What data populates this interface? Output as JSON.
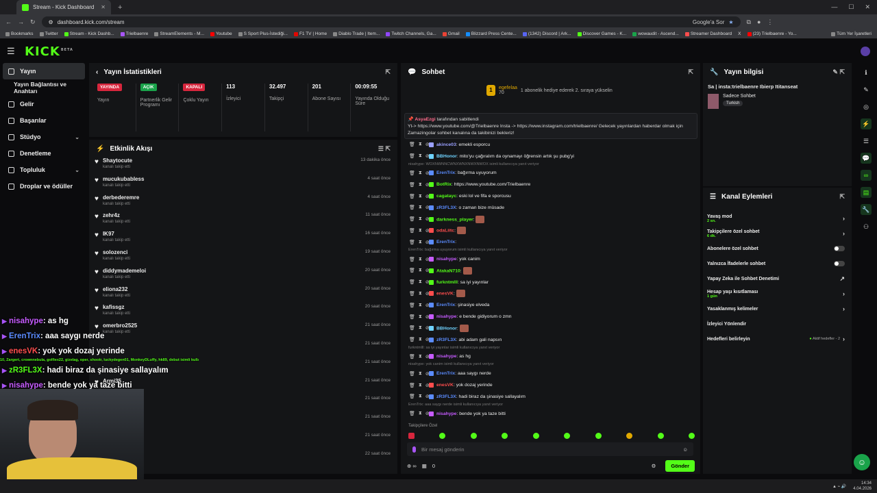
{
  "browser": {
    "tab_title": "Stream - Kick Dashboard",
    "url": "dashboard.kick.com/stream",
    "search_label": "Google'a Sor",
    "bookmarks": [
      "Bookmarks",
      "Twitter",
      "Stream - Kick Dashb...",
      "Trielbaenre",
      "StreamElements - M...",
      "Youtube",
      "S Sport Plus-İstediği...",
      "F1 TV | Home",
      "Diablo Trade | Item...",
      "Twitch Channels, Ga...",
      "Gmail",
      "Blizzard Press Cente...",
      "(1342) Discord | Ark...",
      "Discover Games - K...",
      "wowaudit - Ascend...",
      "Streamer Dashboard",
      "X",
      "(23) Trielbaenre - Yo..."
    ],
    "all_bookmarks": "Tüm Yer İşaretleri"
  },
  "sidebar": {
    "items": [
      {
        "label": "Yayın"
      },
      {
        "label": "Yayın Bağlantısı ve Anahtarı"
      },
      {
        "label": "Gelir"
      },
      {
        "label": "Başarılar"
      },
      {
        "label": "Stüdyo"
      },
      {
        "label": "Denetleme"
      },
      {
        "label": "Topluluk"
      },
      {
        "label": "Droplar ve ödüller"
      }
    ]
  },
  "stats": {
    "title": "Yayın İstatistikleri",
    "items": [
      {
        "pill": "YAYINDA",
        "label": "Yayın",
        "color": "#d7263d"
      },
      {
        "pill": "AÇIK",
        "label": "Partnerlik Gelir Programı",
        "color": "#1aa34a"
      },
      {
        "pill": "KAPALI",
        "label": "Çoklu Yayın",
        "color": "#d7263d"
      },
      {
        "value": "113",
        "label": "İzleyici"
      },
      {
        "value": "32.497",
        "label": "Takipçi"
      },
      {
        "value": "201",
        "label": "Abone Sayısı"
      },
      {
        "value": "00:09:55",
        "label": "Yayında Olduğu Süre"
      }
    ]
  },
  "activity": {
    "title": "Etkinlik Akışı",
    "rows": [
      {
        "name": "Shaytocute",
        "sub": "kanalı takip etti",
        "when": "13 dakika önce"
      },
      {
        "name": "mucukubabless",
        "sub": "kanalı takip etti",
        "when": "4 saat önce"
      },
      {
        "name": "derbederemre",
        "sub": "kanalı takip etti",
        "when": "4 saat önce"
      },
      {
        "name": "zehr4z",
        "sub": "kanalı takip etti",
        "when": "11 saat önce"
      },
      {
        "name": "IK97",
        "sub": "kanalı takip etti",
        "when": "16 saat önce"
      },
      {
        "name": "solozenci",
        "sub": "kanalı takip etti",
        "when": "19 saat önce"
      },
      {
        "name": "diddymademeloi",
        "sub": "kanalı takip etti",
        "when": "20 saat önce"
      },
      {
        "name": "eliona232",
        "sub": "kanalı takip etti",
        "when": "20 saat önce"
      },
      {
        "name": "kafissgz",
        "sub": "kanalı takip etti",
        "when": "20 saat önce"
      },
      {
        "name": "omerbro2525",
        "sub": "kanalı takip etti",
        "when": "21 saat önce"
      },
      {
        "name": "",
        "sub": "",
        "when": "21 saat önce"
      },
      {
        "name": "",
        "sub": "",
        "when": "21 saat önce"
      },
      {
        "name": "Armi35",
        "sub": "",
        "when": "21 saat önce"
      },
      {
        "name": "",
        "sub": "",
        "when": "21 saat önce"
      },
      {
        "name": "",
        "sub": "",
        "when": "21 saat önce"
      },
      {
        "name": "",
        "sub": "",
        "when": "21 saat önce"
      },
      {
        "name": "",
        "sub": "",
        "when": "22 saat önce"
      }
    ]
  },
  "chat": {
    "title": "Sohbet",
    "hype_user": "egefelaa",
    "hype_count": "70",
    "hype_text": "1 abonelik hediye ederek 2. sıraya yükselin",
    "pinned_by": "AsyaEzgi",
    "pinned_by_suffix": "tarafından sabitlendi",
    "pinned_text": "Yt-> https://www.youtube.com/@Trielbaenre Insta -> https://www.instagram.com/trielbaenre/ Gelecek yayınlardan haberdar olmak için Zamazingolar sohbet kanalına da takibinizi bekleriz!",
    "messages": [
      {
        "user": "akince03",
        "text": "emekli esporcu",
        "color": "#9aa0ff"
      },
      {
        "user": "BBHonor",
        "text": "mito'yu çağıralım da oynamayı öğrensin artık şu pubg'yi",
        "color": "#6fd3ff"
      },
      {
        "reply": "nisahype: WOXNWNNCWNXWNXNWXNWOX isimli kullanıcıya yanıt veriyor"
      },
      {
        "user": "ErenTrix",
        "text": "bağırma uyuyorum",
        "color": "#5b8cff"
      },
      {
        "user": "BotRix",
        "text": "https://www.youtube.com/Trielbaenre",
        "color": "#53fc18"
      },
      {
        "user": "cagatayc",
        "text": "eski lol ve fifa e sporcusu",
        "color": "#53fc18"
      },
      {
        "user": "zR3FL3X",
        "text": "o zaman bize müsade",
        "color": "#5b8cff"
      },
      {
        "user": "darkness_player",
        "text": "",
        "color": "#53fc18",
        "emote": true
      },
      {
        "user": "odaLiitc",
        "text": "",
        "color": "#ff4d4d",
        "emote": true
      },
      {
        "user": "ErenTrix",
        "text": "",
        "color": "#5b8cff"
      },
      {
        "reply": "ErenTrix: bağırma uyuyorum isimli kullanıcıya yanıt veriyor"
      },
      {
        "user": "nisahype",
        "text": "yok canim",
        "color": "#c65bff"
      },
      {
        "user": "AtakaN710",
        "text": "",
        "color": "#53fc18",
        "emote": true
      },
      {
        "user": "furkntmlll",
        "text": "sa iyi yayınlar",
        "color": "#53fc18"
      },
      {
        "user": "enesVK",
        "text": "",
        "color": "#ff4d4d",
        "emote": true
      },
      {
        "user": "ErenTrix",
        "text": "şinasiye elveda",
        "color": "#5b8cff"
      },
      {
        "user": "nisahype",
        "text": "e bende gidiyorum o zmn",
        "color": "#c65bff"
      },
      {
        "user": "BBHonor",
        "text": "",
        "color": "#6fd3ff",
        "emote": true
      },
      {
        "user": "zR3FL3X",
        "text": "abi adam gali napsın",
        "color": "#5b8cff"
      },
      {
        "reply": "furkntmlll: sa iyi yayınlar isimli kullanıcıya yanıt veriyor"
      },
      {
        "user": "nisahype",
        "text": "as hg",
        "color": "#c65bff"
      },
      {
        "reply": "nisahype: yok canim isimli kullanıcıya yanıt veriyor"
      },
      {
        "user": "ErenTrix",
        "text": "aaa saygı nerde",
        "color": "#5b8cff"
      },
      {
        "user": "enesVK",
        "text": "yok dozaj yerinde",
        "color": "#ff4d4d"
      },
      {
        "user": "zR3FL3X",
        "text": "hadi biraz da şinasiye sallayalım",
        "color": "#5b8cff"
      },
      {
        "reply": "ErenTrix: aaa saygı nerde isimli kullanıcıya yanıt veriyor"
      },
      {
        "user": "nisahype",
        "text": "bende yok ya taze bitti",
        "color": "#c65bff"
      }
    ],
    "followers_only_label": "Takipçilere Özel",
    "input_placeholder": "Bir mesaj gönderin",
    "viewers_count": "0",
    "send_label": "Gönder"
  },
  "info": {
    "title": "Yayın bilgisi",
    "stream_title": "Sa | insta:trielbaenre Ibierp Ititanseat",
    "category": "Sadece Sohbet",
    "tag": "Turkish"
  },
  "actions": {
    "title": "Kanal Eylemleri",
    "rows": [
      {
        "label": "Yavaş mod",
        "small": "2 sn."
      },
      {
        "label": "Takipçilere özel sohbet",
        "small": "6 dk."
      },
      {
        "label": "Abonelere özel sohbet"
      },
      {
        "label": "Yalnızca İfadelerle sohbet"
      },
      {
        "label": "Yapay Zeka ile Sohbet Denetimi"
      },
      {
        "label": "Hesap yaşı kısıtlaması",
        "small": "1 gün"
      },
      {
        "label": "Yasaklanmış kelimeler"
      },
      {
        "label": "İzleyici Yönlendir"
      },
      {
        "label": "Hedefleri belirleyin",
        "note": "Aktif hedefler - 2"
      }
    ]
  },
  "overlay": {
    "lines": [
      {
        "user": "nisahype",
        "text": ": as hg",
        "color": "#c65bff"
      },
      {
        "user": "ErenTrix",
        "text": ": aaa saygı nerde",
        "color": "#5b8cff"
      },
      {
        "user": "enesVK",
        "text": ": yok yok dozaj yerinde",
        "color": "#ff4d4d"
      },
      {
        "user": "zR3FL3X",
        "text": ": hadi biraz da şinasiye sallayalım",
        "color": "#53fc18"
      },
      {
        "user": "nisahype",
        "text": ": bende yok ya taze bitti",
        "color": "#c65bff"
      }
    ],
    "sub_note": "10, Zargert, crownnebula, golfiex22, gizelag, oper, shootr, luckydegen01, MonkeyDLuffy, hk89, debut isimli kullanıcıya abonelik hediye etti."
  },
  "taskbar": {
    "time": "14:34",
    "date": "4.04.2026"
  }
}
